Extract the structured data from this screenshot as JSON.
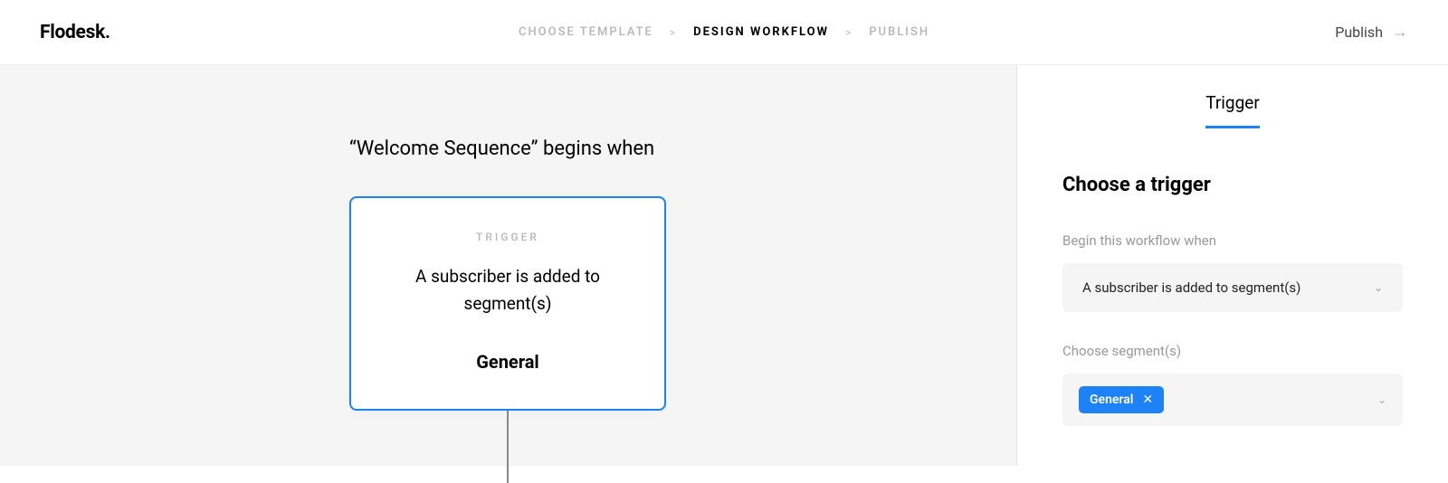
{
  "header": {
    "logo": "Flodesk.",
    "steps": {
      "choose_template": "CHOOSE TEMPLATE",
      "design_workflow": "DESIGN WORKFLOW",
      "publish": "PUBLISH"
    },
    "publish_button": "Publish"
  },
  "canvas": {
    "title": "“Welcome Sequence” begins when",
    "trigger_card": {
      "eyebrow": "TRIGGER",
      "description": "A subscriber is added to segment(s)",
      "segment": "General"
    }
  },
  "sidebar": {
    "tab": "Trigger",
    "heading": "Choose a trigger",
    "begin_label": "Begin this workflow when",
    "begin_value": "A subscriber is added to segment(s)",
    "segments_label": "Choose segment(s)",
    "segment_chip": "General"
  }
}
